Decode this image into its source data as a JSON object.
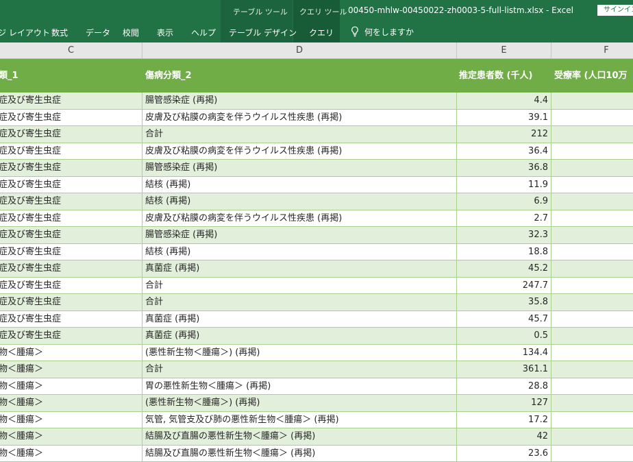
{
  "ribbon": {
    "tabs": {
      "layout": "ジ レイアウト",
      "formulas": "数式",
      "data": "データ",
      "review": "校閲",
      "view": "表示",
      "help": "ヘルプ",
      "table_design": "テーブル デザイン",
      "query": "クエリ"
    },
    "context_table_tools": "テーブル ツール",
    "context_query_tools": "クエリ ツール",
    "title": "00450-mhlw-00450022-zh0003-5-full-listm.xlsx  -  Excel",
    "signin": "サインイン",
    "tell_me": "何をしますか",
    "tell_me_icon": "lightbulb-icon"
  },
  "columns": [
    "C",
    "D",
    "E",
    "F"
  ],
  "table_headers": {
    "c": "類_1",
    "d": "傷病分類_2",
    "e": "推定患者数 (千人)",
    "f": "受療率 (人口10万"
  },
  "rows": [
    {
      "c": "症及び寄生虫症",
      "d": "腸管感染症 (再掲)",
      "e": "4.4"
    },
    {
      "c": "症及び寄生虫症",
      "d": "皮膚及び粘膜の病変を伴うウイルス性疾患 (再掲)",
      "e": "39.1"
    },
    {
      "c": "症及び寄生虫症",
      "d": "合計",
      "e": "212"
    },
    {
      "c": "症及び寄生虫症",
      "d": "皮膚及び粘膜の病変を伴うウイルス性疾患 (再掲)",
      "e": "36.4"
    },
    {
      "c": "症及び寄生虫症",
      "d": "腸管感染症 (再掲)",
      "e": "36.8"
    },
    {
      "c": "症及び寄生虫症",
      "d": "結核 (再掲)",
      "e": "11.9"
    },
    {
      "c": "症及び寄生虫症",
      "d": "結核 (再掲)",
      "e": "6.9"
    },
    {
      "c": "症及び寄生虫症",
      "d": "皮膚及び粘膜の病変を伴うウイルス性疾患 (再掲)",
      "e": "2.7"
    },
    {
      "c": "症及び寄生虫症",
      "d": "腸管感染症 (再掲)",
      "e": "32.3"
    },
    {
      "c": "症及び寄生虫症",
      "d": "結核 (再掲)",
      "e": "18.8"
    },
    {
      "c": "症及び寄生虫症",
      "d": "真菌症 (再掲)",
      "e": "45.2"
    },
    {
      "c": "症及び寄生虫症",
      "d": "合計",
      "e": "247.7"
    },
    {
      "c": "症及び寄生虫症",
      "d": "合計",
      "e": "35.8"
    },
    {
      "c": "症及び寄生虫症",
      "d": "真菌症 (再掲)",
      "e": "45.7"
    },
    {
      "c": "症及び寄生虫症",
      "d": "真菌症 (再掲)",
      "e": "0.5"
    },
    {
      "c": "物＜腫瘍＞",
      "d": " (悪性新生物＜腫瘍＞) (再掲)",
      "e": "134.4"
    },
    {
      "c": "物＜腫瘍＞",
      "d": "合計",
      "e": "361.1"
    },
    {
      "c": "物＜腫瘍＞",
      "d": "胃の悪性新生物＜腫瘍＞ (再掲)",
      "e": "28.8"
    },
    {
      "c": "物＜腫瘍＞",
      "d": " (悪性新生物＜腫瘍＞) (再掲)",
      "e": "127"
    },
    {
      "c": "物＜腫瘍＞",
      "d": "気管, 気管支及び肺の悪性新生物＜腫瘍＞ (再掲)",
      "e": "17.2"
    },
    {
      "c": "物＜腫瘍＞",
      "d": "結腸及び直腸の悪性新生物＜腫瘍＞ (再掲)",
      "e": "42"
    },
    {
      "c": "物＜腫瘍＞",
      "d": "結腸及び直腸の悪性新生物＜腫瘍＞ (再掲)",
      "e": "23.6"
    }
  ]
}
